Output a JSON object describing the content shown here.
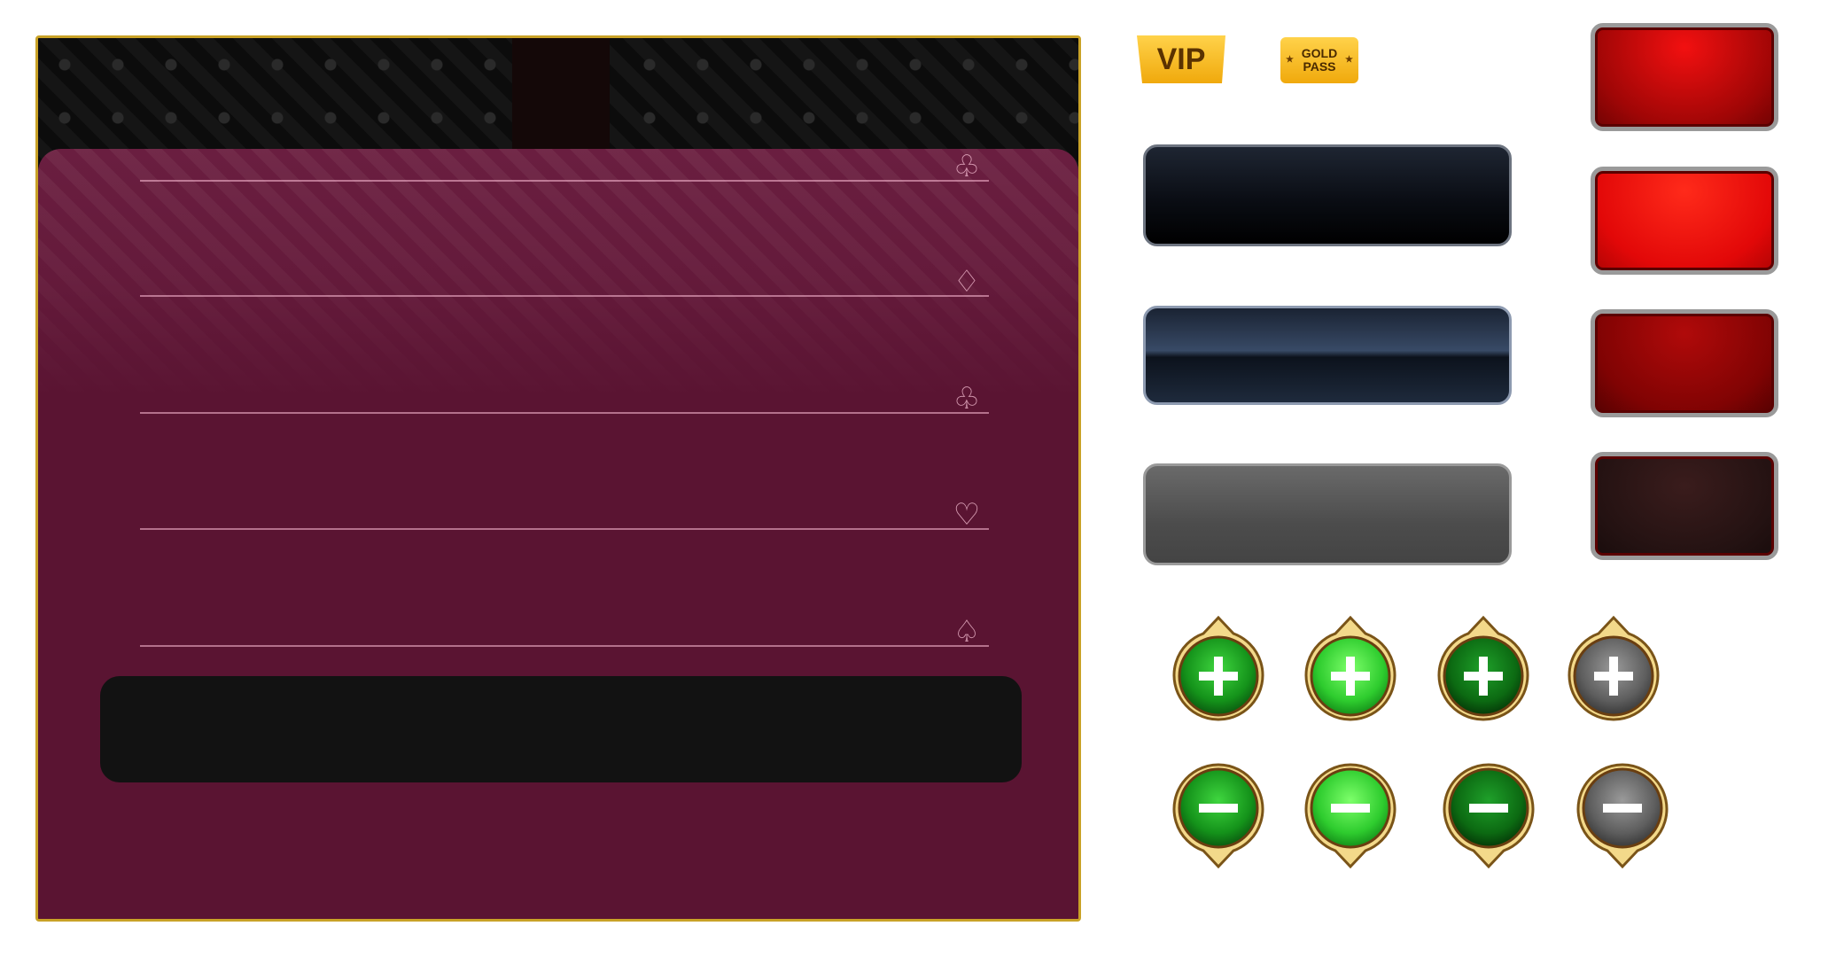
{
  "badges": {
    "vip": "VIP",
    "gold_pass_line1": "GOLD",
    "gold_pass_line2": "PASS"
  },
  "form_rows": [
    {
      "icon": "club-icon",
      "glyph": "♧"
    },
    {
      "icon": "diamond-icon",
      "glyph": "♢"
    },
    {
      "icon": "club-icon",
      "glyph": "♧"
    },
    {
      "icon": "heart-icon",
      "glyph": "♡"
    },
    {
      "icon": "spade-icon",
      "glyph": "♤"
    }
  ],
  "colors": {
    "panel_bg": "#5a1432",
    "panel_border": "#c9a227",
    "gold": "#f0a90c",
    "green_bright": "#2ecc2e",
    "red": "#e20808"
  }
}
